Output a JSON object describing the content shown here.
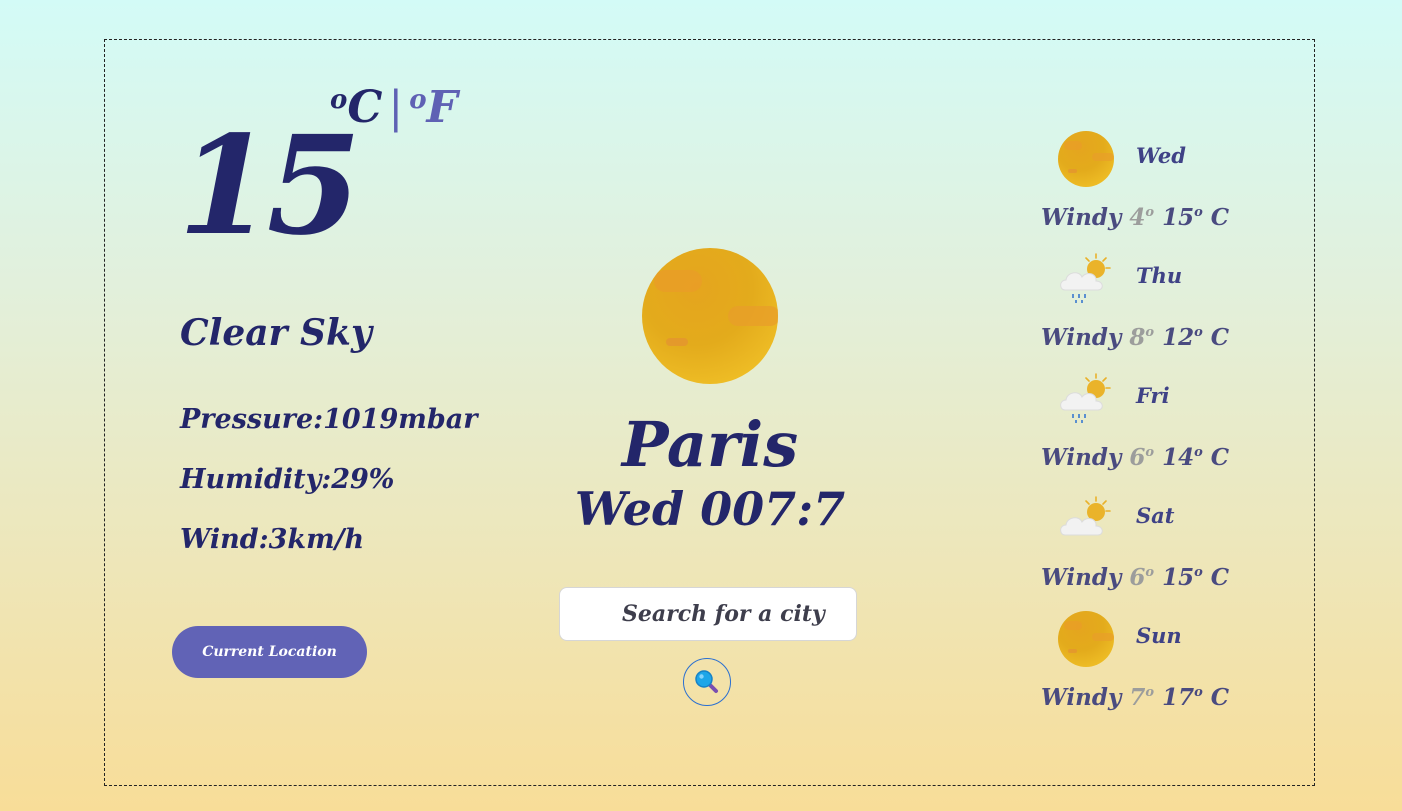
{
  "current": {
    "temperature": "15",
    "unit_celsius": "C",
    "unit_separator": "|",
    "unit_fahrenheit": "F",
    "degree_mark": "o",
    "condition": "Clear Sky",
    "pressure": "Pressure:1019mbar",
    "humidity": "Humidity:29%",
    "wind": "Wind:3km/h",
    "icon": "sun-icon"
  },
  "location": {
    "city": "Paris",
    "datetime": "Wed 007:7"
  },
  "actions": {
    "current_location_label": "Current Location",
    "search_placeholder": "Search for a city",
    "search_icon": "magnifier-icon"
  },
  "forecast": [
    {
      "day": "Wed",
      "condition": "Windy",
      "min": "4",
      "max": "15",
      "unit": "C",
      "icon": "sun-icon"
    },
    {
      "day": "Thu",
      "condition": "Windy",
      "min": "8",
      "max": "12",
      "unit": "C",
      "icon": "cloud-sun-rain-icon"
    },
    {
      "day": "Fri",
      "condition": "Windy",
      "min": "6",
      "max": "14",
      "unit": "C",
      "icon": "cloud-sun-rain-icon"
    },
    {
      "day": "Sat",
      "condition": "Windy",
      "min": "6",
      "max": "15",
      "unit": "C",
      "icon": "cloud-sun-icon"
    },
    {
      "day": "Sun",
      "condition": "Windy",
      "min": "7",
      "max": "17",
      "unit": "C",
      "icon": "sun-icon"
    }
  ],
  "colors": {
    "primary_text": "#23266a",
    "accent": "#6163b6",
    "forecast_min": "#9c9d9c"
  }
}
